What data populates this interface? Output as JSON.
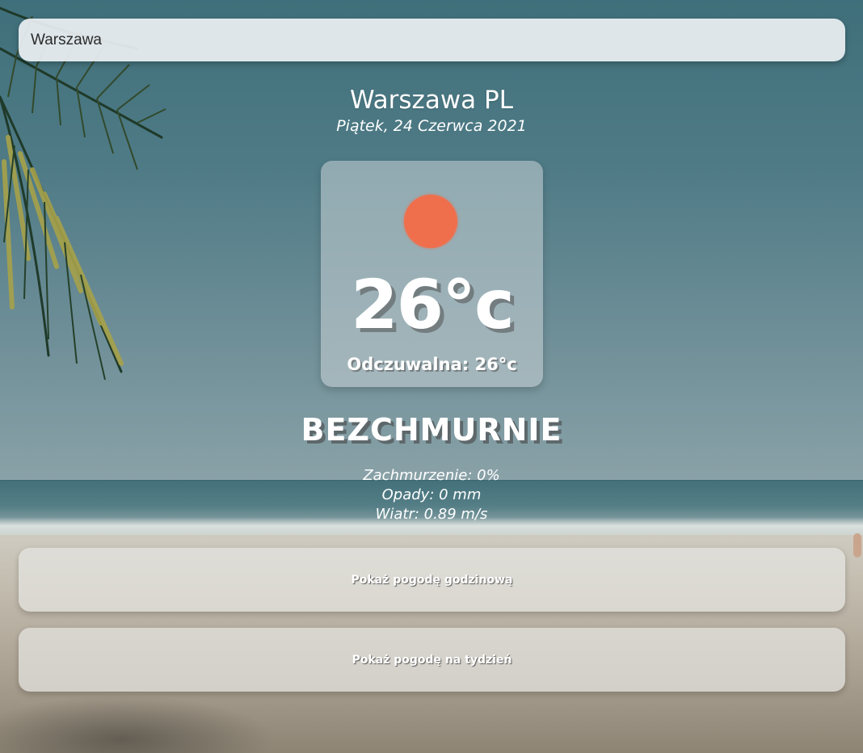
{
  "search": {
    "value": "Warszawa"
  },
  "location": {
    "city_country": "Warszawa PL",
    "date": "Piątek, 24 Czerwca 2021"
  },
  "current": {
    "icon": "sun-icon",
    "icon_color": "#ef6f4d",
    "temperature": "26°c",
    "feels_like": "Odczuwalna: 26°c",
    "condition": "BEZCHMURNIE"
  },
  "details": {
    "cloudiness": "Zachmurzenie: 0%",
    "precipitation": "Opady: 0 mm",
    "wind": "Wiatr: 0.89 m/s"
  },
  "actions": {
    "hourly_label": "Pokaż pogodę godzinową",
    "weekly_label": "Pokaż pogodę na tydzień"
  }
}
